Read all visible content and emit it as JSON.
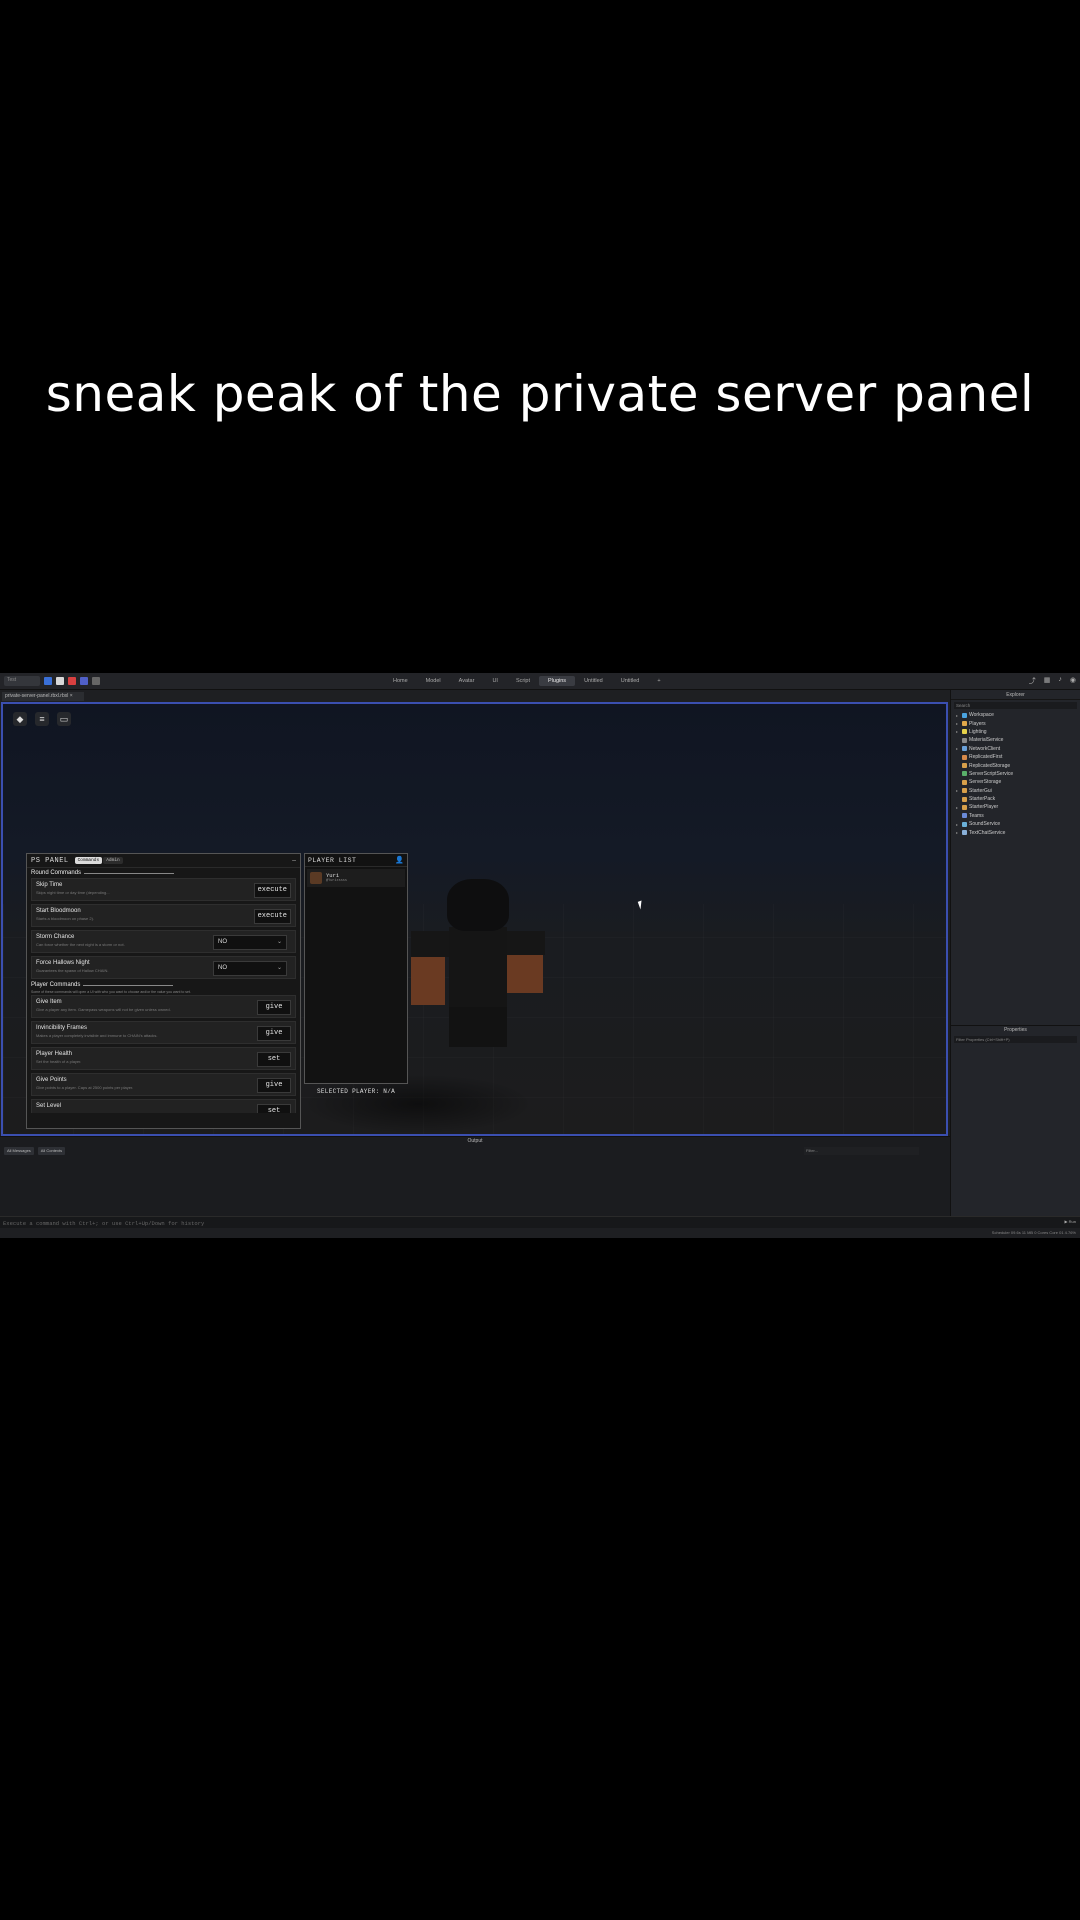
{
  "caption": "sneak peak of the private server panel",
  "studio": {
    "topbar": {
      "tabs": [
        "Home",
        "Model",
        "Avatar",
        "UI",
        "Script",
        "Plugins",
        "Untitled",
        "Untitled",
        "+"
      ],
      "active_tab_index": 5
    },
    "file_tab": "private-server-panel.rbxl.rbxl ×",
    "ps_panel": {
      "title": "PS PANEL",
      "tabs": [
        "Commands",
        "Admin"
      ],
      "minimize": "–",
      "round_section": "Round Commands",
      "player_section": "Player Commands",
      "player_section_note": "Some of these commands will open a UI with who you want to choose and/or the value you want to set.",
      "round_rows": [
        {
          "title": "Skip Time",
          "desc": "Skips night time or day time (depending...",
          "control": "execute"
        },
        {
          "title": "Start Bloodmoon",
          "desc": "Starts a bloodmoon on phase 2).",
          "control": "execute"
        },
        {
          "title": "Storm Chance",
          "desc": "Can force whether the next night is a storm or not.",
          "select": "NO"
        },
        {
          "title": "Force Hallows Night",
          "desc": "Guarantees the spawn of Hallow CHAIN.",
          "select": "NO"
        }
      ],
      "player_rows": [
        {
          "title": "Give Item",
          "desc": "Give a player any item. Gamepass weapons will not be given unless owned.",
          "control": "give"
        },
        {
          "title": "Invincibility Frames",
          "desc": "Makes a player completely invisible and immune to CHAIN's attacks.",
          "control": "give"
        },
        {
          "title": "Player Health",
          "desc": "Set the health of a player.",
          "control": "set"
        },
        {
          "title": "Give Points",
          "desc": "Give points to a player. Caps at 2500 points per player.",
          "control": "give"
        },
        {
          "title": "Set Level",
          "desc": "",
          "control": "set"
        }
      ]
    },
    "player_list": {
      "title": "PLAYER LIST",
      "players": [
        {
          "name": "Yuri",
          "username": "@Yurixssss"
        }
      ],
      "selected": "SELECTED PLAYER: N/A"
    },
    "explorer": {
      "title": "Explorer",
      "search_placeholder": "Search",
      "items": [
        {
          "name": "Workspace",
          "color": "#4aa3df",
          "arrow": "▸"
        },
        {
          "name": "Players",
          "color": "#e0a84a",
          "arrow": "▸"
        },
        {
          "name": "Lighting",
          "color": "#e6d24a",
          "arrow": "▸"
        },
        {
          "name": "MaterialService",
          "color": "#8a8a8a",
          "arrow": ""
        },
        {
          "name": "NetworkClient",
          "color": "#6aa0d8",
          "arrow": "▸"
        },
        {
          "name": "ReplicatedFirst",
          "color": "#d88a4a",
          "arrow": ""
        },
        {
          "name": "ReplicatedStorage",
          "color": "#d8a04a",
          "arrow": ""
        },
        {
          "name": "ServerScriptService",
          "color": "#5ab06a",
          "arrow": ""
        },
        {
          "name": "ServerStorage",
          "color": "#d8a04a",
          "arrow": ""
        },
        {
          "name": "StarterGui",
          "color": "#d8a04a",
          "arrow": "▸"
        },
        {
          "name": "StarterPack",
          "color": "#d8a04a",
          "arrow": ""
        },
        {
          "name": "StarterPlayer",
          "color": "#d8a04a",
          "arrow": "▸"
        },
        {
          "name": "Teams",
          "color": "#6a8ad8",
          "arrow": ""
        },
        {
          "name": "SoundService",
          "color": "#6ab0d8",
          "arrow": "▸"
        },
        {
          "name": "TextChatService",
          "color": "#8ab0d8",
          "arrow": "▸"
        }
      ]
    },
    "properties": {
      "title": "Properties",
      "filter_placeholder": "Filter Properties (Ctrl+Shift+P)"
    },
    "output": {
      "title": "Output",
      "dropdowns": [
        "All Messages",
        "All Contexts"
      ],
      "filter_placeholder": "Filter..."
    },
    "command_bar": {
      "placeholder": "Execute a command with Ctrl+; or use Ctrl+Up/Down for history",
      "run_label": "▶ Run"
    },
    "status": "Scheduler 09.6s   11 MB   0 Cores   Core 01   4.76%"
  }
}
